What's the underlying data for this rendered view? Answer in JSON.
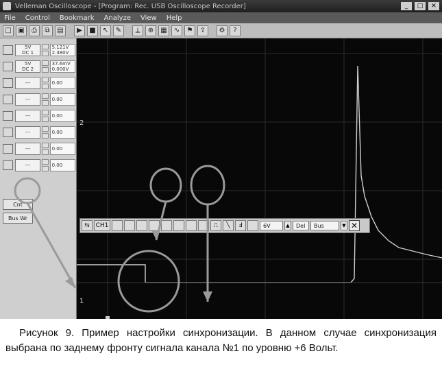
{
  "window": {
    "title": "Velleman Oscilloscope - [Program: Rec. USB Oscilloscope Recorder]",
    "minimize": "_",
    "maximize": "□",
    "close": "✕"
  },
  "menu": [
    "File",
    "Control",
    "Bookmark",
    "Analyze",
    "View",
    "Help"
  ],
  "toolbar_icons": [
    "new-icon",
    "save-icon",
    "print-icon",
    "copy-icon",
    "paste-icon",
    "run-icon",
    "stop-icon",
    "cursor-icon",
    "measure-icon",
    "ruler-icon",
    "zoom-icon",
    "grid-icon",
    "fft-icon",
    "bookmark-icon",
    "export-icon",
    "settings-icon",
    "help-icon"
  ],
  "channels": [
    {
      "label": "5V\nDC 1",
      "value_top": "5.121V",
      "value_bottom": "2.380V"
    },
    {
      "label": "5V\nDC 2",
      "value_top": "37.6mV",
      "value_bottom": "0.000V"
    }
  ],
  "empty_channel_placeholder": "---",
  "channel_value_placeholder": "0.00",
  "trigger_toolbar": {
    "channel_selected": "CH1",
    "level_value": "6V",
    "mode_label": "Del",
    "mode_value": "Bus"
  },
  "side_buttons": {
    "btn1": "Cnt",
    "btn2": "Bus Wr"
  },
  "scope_markers": {
    "trace_ref_1": "1",
    "trace_ref_2": "2"
  },
  "caption": {
    "text": "Рисунок 9. Пример настройки синхронизации. В данном случае синхронизация выбрана по заднему фронту сигнала канала №1 по уровню +6 Вольт."
  },
  "colors": {
    "scope_background": "#080808",
    "trace": "#cfcfcf",
    "annotation": "#9a9a9a"
  }
}
